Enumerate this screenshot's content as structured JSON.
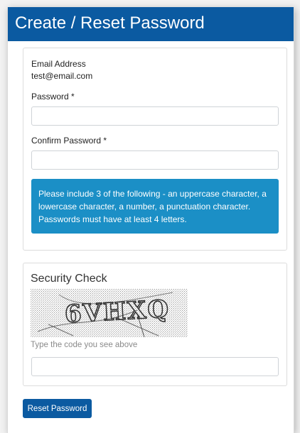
{
  "header": {
    "title": "Create / Reset Password"
  },
  "form": {
    "email_label": "Email Address",
    "email_value": "test@email.com",
    "password_label": "Password *",
    "password_value": "",
    "confirm_label": "Confirm Password *",
    "confirm_value": "",
    "hint": "Please include 3 of the following - an uppercase character, a lowercase character, a number, a punctuation character. Passwords must have at least 4 letters."
  },
  "security": {
    "title": "Security Check",
    "captcha_code": "6VHXQ",
    "caption": "Type the code you see above",
    "code_value": ""
  },
  "actions": {
    "reset_label": "Reset Password"
  },
  "colors": {
    "header_bg": "#0b5aa1",
    "hint_bg": "#1b8fc6",
    "button_bg": "#0b5aa1"
  }
}
